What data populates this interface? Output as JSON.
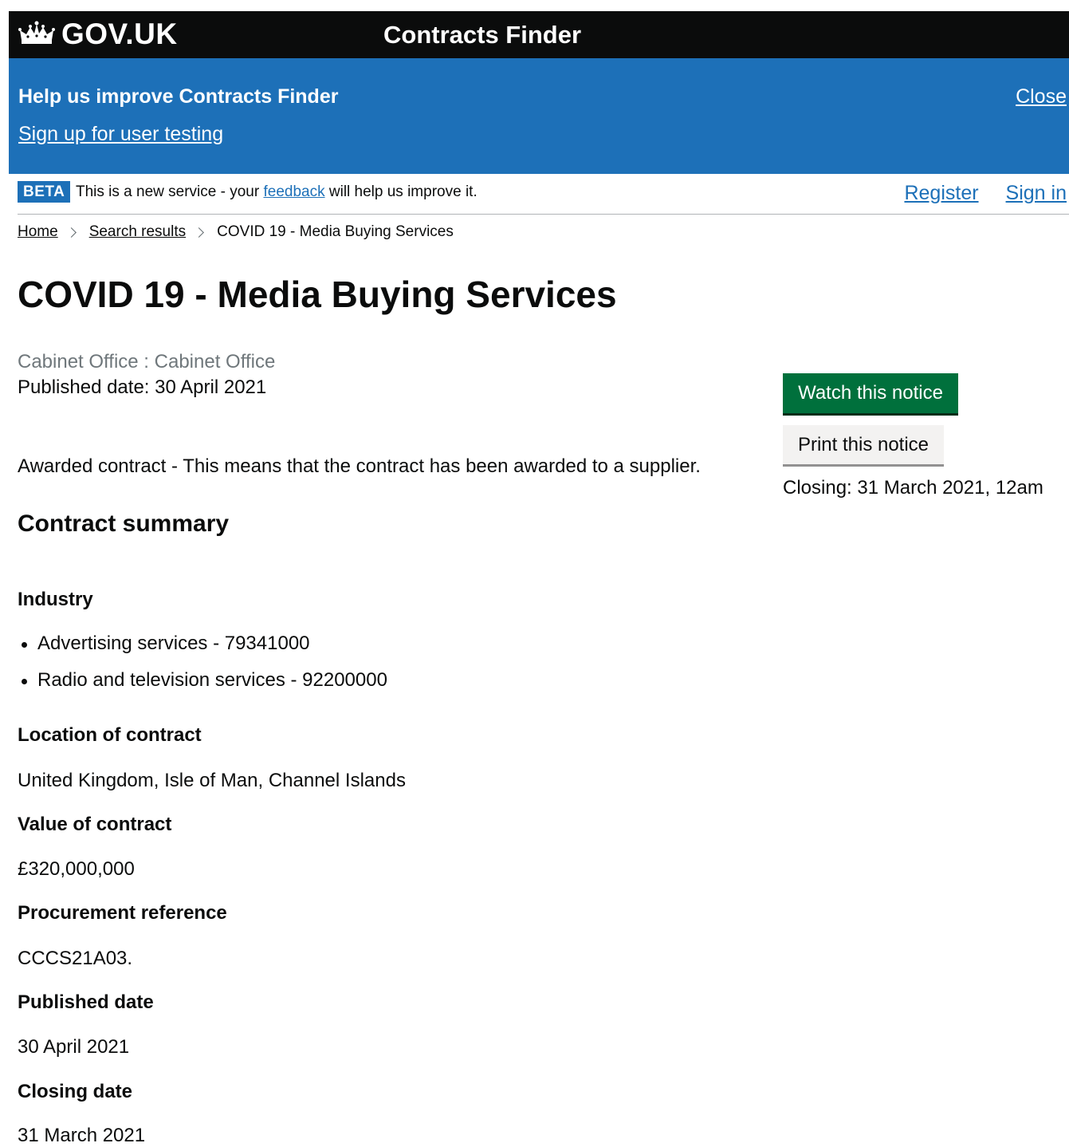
{
  "header": {
    "logo_text": "GOV.UK",
    "service_name": "Contracts Finder"
  },
  "banner": {
    "title": "Help us improve Contracts Finder",
    "link": "Sign up for user testing",
    "close": "Close"
  },
  "phase": {
    "tag": "BETA",
    "text_before": "This is a new service - your ",
    "feedback_link": "feedback",
    "text_after": " will help us improve it.",
    "register": "Register",
    "sign_in": "Sign in"
  },
  "breadcrumb": {
    "items": [
      "Home",
      "Search results"
    ],
    "current": "COVID 19 - Media Buying Services"
  },
  "notice": {
    "title": "COVID 19 - Media Buying Services",
    "organisation": "Cabinet Office : Cabinet Office",
    "published": "Published date: 30 April 2021",
    "status": "Awarded contract - This means that the contract has been awarded to a supplier."
  },
  "actions": {
    "watch": "Watch this notice",
    "print": "Print this notice",
    "closing": "Closing: 31 March 2021, 12am"
  },
  "summary": {
    "heading": "Contract summary",
    "industry_label": "Industry",
    "industries": [
      "Advertising services - 79341000",
      "Radio and television services - 92200000"
    ],
    "location_label": "Location of contract",
    "location": "United Kingdom, Isle of Man, Channel Islands",
    "value_label": "Value of contract",
    "value": "£320,000,000",
    "reference_label": "Procurement reference",
    "reference": "CCCS21A03.",
    "published_label": "Published date",
    "published": "30 April 2021",
    "closing_label": "Closing date",
    "closing": "31 March 2021"
  }
}
